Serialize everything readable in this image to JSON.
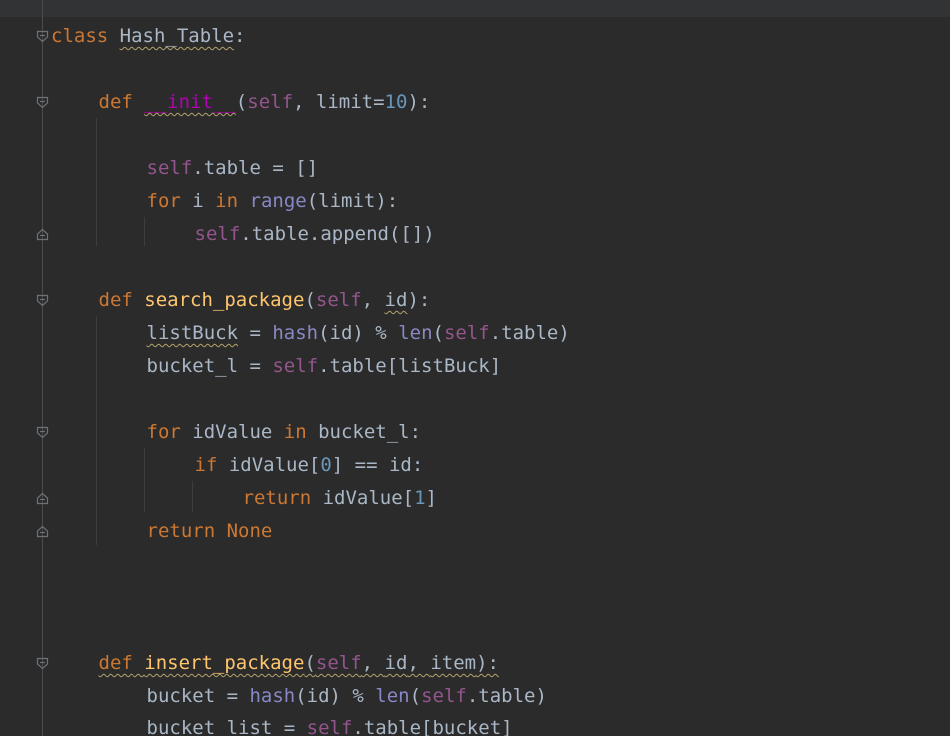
{
  "editor": {
    "language": "python",
    "colors": {
      "background": "#2b2b2b",
      "keyword": "#cc7832",
      "self": "#94558d",
      "function": "#ffc66d",
      "dunder": "#b200b2",
      "number": "#6897bb",
      "builtin": "#8888c6",
      "default": "#a9b7c6"
    },
    "icons": {
      "fold_open": "fold-open-icon",
      "fold_close": "fold-close-icon"
    },
    "code": {
      "l1": {
        "kw": "class",
        "name": "Hash_Table",
        "colon": ":"
      },
      "l3": {
        "kw": "def",
        "name": "__init__",
        "open": "(",
        "self": "self",
        "sep": ", ",
        "param": "limit=",
        "num": "10",
        "close": "):"
      },
      "l5": {
        "self": "self",
        "rest": ".table = []"
      },
      "l6": {
        "kw1": "for",
        "mid": " i ",
        "kw2": "in",
        "sp": " ",
        "builtin": "range",
        "rest": "(limit):"
      },
      "l7": {
        "self": "self",
        "rest": ".table.append([])"
      },
      "l9": {
        "kw": "def",
        "name": "search_package",
        "open": "(",
        "self": "self",
        "sep": ", ",
        "param": "id",
        "close": "):"
      },
      "l10": {
        "var": "listBuck",
        "eq": " = ",
        "b1": "hash",
        "m1": "(id) % ",
        "b2": "len",
        "m2": "(",
        "self": "self",
        "rest": ".table)"
      },
      "l11": {
        "lead": "bucket_l = ",
        "self": "self",
        "rest": ".table[listBuck]"
      },
      "l13": {
        "kw1": "for",
        "mid": " idValue ",
        "kw2": "in",
        "rest": " bucket_l:"
      },
      "l14": {
        "kw": "if",
        "a": " idValue[",
        "num": "0",
        "b": "] == id:"
      },
      "l15": {
        "kw": "return",
        "a": " idValue[",
        "num": "1",
        "b": "]"
      },
      "l16": {
        "kw1": "return",
        "sp": " ",
        "kw2": "None"
      },
      "l20": {
        "kw": "def",
        "name": "insert_package",
        "open": "(",
        "self": "self",
        "sep": ", ",
        "p1": "id",
        "sep2": ", ",
        "p2": "item",
        "close": "):"
      },
      "l21": {
        "lead": "bucket = ",
        "b1": "hash",
        "m1": "(id) % ",
        "b2": "len",
        "m2": "(",
        "self": "self",
        "rest": ".table)"
      },
      "l22": {
        "lead": "bucket_list = ",
        "self": "self",
        "rest": ".table[bucket]"
      }
    }
  }
}
